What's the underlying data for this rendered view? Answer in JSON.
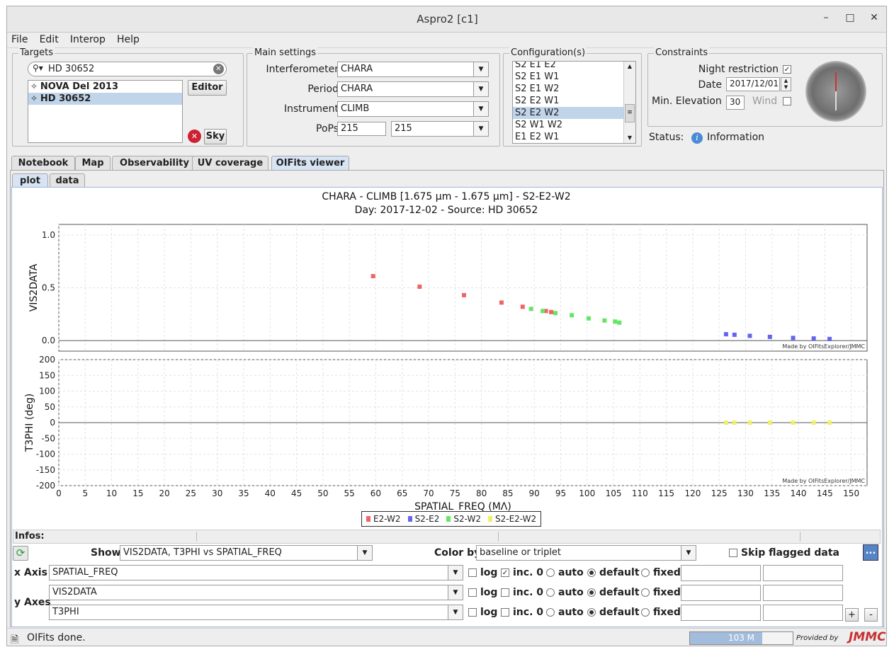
{
  "window": {
    "title": "Aspro2 [c1]",
    "minimize": "–",
    "maximize": "□",
    "close": "✕"
  },
  "menu": [
    "File",
    "Edit",
    "Interop",
    "Help"
  ],
  "targets": {
    "panel_title": "Targets",
    "search_value": "HD 30652",
    "items": [
      {
        "name": "NOVA Del 2013",
        "selected": false
      },
      {
        "name": "HD 30652",
        "selected": true
      }
    ],
    "editor_label": "Editor",
    "sky_label": "Sky"
  },
  "main_settings": {
    "panel_title": "Main settings",
    "interferometer_label": "Interferometer",
    "interferometer_value": "CHARA",
    "period_label": "Period",
    "period_value": "CHARA",
    "instrument_label": "Instrument",
    "instrument_value": "CLIMB",
    "pops_label": "PoPs",
    "pops_text": "215",
    "pops_value": "215"
  },
  "configurations": {
    "panel_title": "Configuration(s)",
    "items": [
      {
        "name": "S2 E1 E2",
        "selected": false
      },
      {
        "name": "S2 E1 W1",
        "selected": false
      },
      {
        "name": "S2 E1 W2",
        "selected": false
      },
      {
        "name": "S2 E2 W1",
        "selected": false
      },
      {
        "name": "S2 E2 W2",
        "selected": true
      },
      {
        "name": "S2 W1 W2",
        "selected": false
      },
      {
        "name": "E1 E2 W1",
        "selected": false
      }
    ]
  },
  "constraints": {
    "panel_title": "Constraints",
    "night_label": "Night restriction",
    "night_checked": true,
    "date_label": "Date",
    "date_value": "2017/12/01",
    "minelev_label": "Min. Elevation",
    "minelev_value": "30",
    "wind_label": "Wind",
    "wind_checked": false,
    "status_label": "Status:",
    "status_value": "Information"
  },
  "tabs": [
    {
      "label": "Notebook",
      "selected": false
    },
    {
      "label": "Map",
      "selected": false
    },
    {
      "label": "Observability",
      "selected": false
    },
    {
      "label": "UV coverage",
      "selected": false
    },
    {
      "label": "OIFits viewer",
      "selected": true
    }
  ],
  "subtabs": [
    {
      "label": "plot",
      "selected": true
    },
    {
      "label": "data",
      "selected": false
    }
  ],
  "plot": {
    "title1": "CHARA - CLIMB [1.675 µm - 1.675 µm] - S2-E2-W2",
    "title2": "Day: 2017-12-02 - Source: HD 30652",
    "watermark": "Made by OIFitsExplorer/JMMC"
  },
  "chart_data": {
    "type": "scatter",
    "xlabel": "SPATIAL_FREQ (MΛ)",
    "xlim": [
      0,
      153
    ],
    "xticks": [
      0,
      5,
      10,
      15,
      20,
      25,
      30,
      35,
      40,
      45,
      50,
      55,
      60,
      65,
      70,
      75,
      80,
      85,
      90,
      95,
      100,
      105,
      110,
      115,
      120,
      125,
      130,
      135,
      140,
      145,
      150
    ],
    "grid": true,
    "legend_position": "bottom",
    "series_colors": {
      "E2-W2": "#f06464",
      "S2-E2": "#6464f0",
      "S2-W2": "#64e664",
      "S2-E2-W2": "#f0f064"
    },
    "panels": [
      {
        "ylabel": "VIS2DATA",
        "ylim": [
          -0.1,
          1.1
        ],
        "yticks": [
          0.0,
          0.5,
          1.0
        ],
        "series": [
          {
            "name": "E2-W2",
            "x": [
              59.5,
              68.3,
              76.7,
              83.8,
              87.8,
              92.2,
              93.2
            ],
            "y": [
              0.61,
              0.51,
              0.43,
              0.36,
              0.32,
              0.28,
              0.27
            ]
          },
          {
            "name": "S2-W2",
            "x": [
              89.4,
              91.6,
              94.0,
              97.1,
              100.3,
              103.3,
              105.3,
              106.1
            ],
            "y": [
              0.3,
              0.28,
              0.26,
              0.24,
              0.21,
              0.19,
              0.18,
              0.17
            ]
          },
          {
            "name": "S2-E2",
            "x": [
              126.3,
              127.9,
              130.8,
              134.6,
              139.0,
              142.9,
              145.9
            ],
            "y": [
              0.06,
              0.055,
              0.045,
              0.035,
              0.025,
              0.02,
              0.015
            ]
          }
        ]
      },
      {
        "ylabel": "T3PHI (deg)",
        "ylim": [
          -200,
          200
        ],
        "yticks": [
          -200,
          -150,
          -100,
          -50,
          0,
          50,
          100,
          150,
          200
        ],
        "series": [
          {
            "name": "S2-E2-W2",
            "x": [
              126.3,
              127.9,
              130.8,
              134.6,
              139.0,
              142.9,
              145.9
            ],
            "y": [
              0,
              0,
              0,
              0,
              0,
              0,
              0
            ]
          }
        ]
      }
    ]
  },
  "infos_label": "Infos:",
  "controls": {
    "show_label": "Show",
    "show_value": "VIS2DATA, T3PHI vs SPATIAL_FREQ",
    "colorby_label": "Color by",
    "colorby_value": "baseline or triplet",
    "skip_label": "Skip flagged data",
    "more_label": "...",
    "xaxis_label": "x Axis",
    "yaxes_label": "y Axes",
    "log_label": "log",
    "inc0_label": "inc. 0",
    "auto_label": "auto",
    "default_label": "default",
    "fixed_label": "fixed",
    "add_label": "+",
    "remove_label": "-",
    "axes": [
      {
        "value": "SPATIAL_FREQ",
        "log": false,
        "inc0": true
      },
      {
        "value": "VIS2DATA",
        "log": false,
        "inc0": false
      },
      {
        "value": "T3PHI",
        "log": false,
        "inc0": false
      }
    ]
  },
  "status": {
    "message": "OIFits done.",
    "memory": "103 M",
    "provided_by": "Provided by",
    "logo": "JMMC"
  }
}
